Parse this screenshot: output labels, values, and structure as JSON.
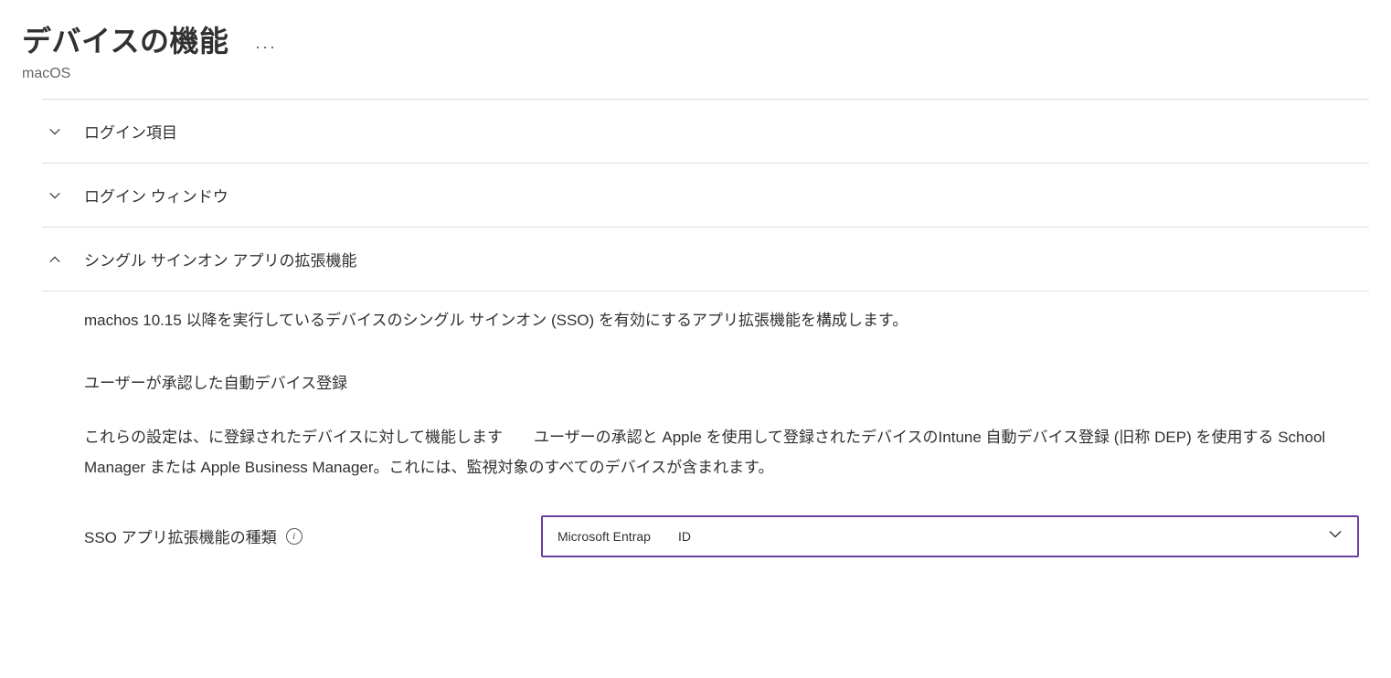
{
  "header": {
    "title": "デバイスの機能",
    "subtitle": "macOS"
  },
  "sections": [
    {
      "label": "ログイン項目",
      "expanded": false
    },
    {
      "label": "ログイン ウィンドウ",
      "expanded": false
    },
    {
      "label": "シングル サインオン アプリの拡張機能",
      "expanded": true
    }
  ],
  "sso": {
    "description": "machos 10.15 以降を実行しているデバイスのシングル サインオン (SSO) を有効にするアプリ拡張機能を構成します。",
    "sub_heading": "ユーザーが承認した自動デバイス登録",
    "paragraph": "これらの設定は、に登録されたデバイスに対して機能します  ユーザーの承認と Apple を使用して登録されたデバイスのIntune 自動デバイス登録 (旧称 DEP) を使用する School Manager または Apple Business Manager。これには、監視対象のすべてのデバイスが含まれます。",
    "field_label": "SSO アプリ拡張機能の種類",
    "select_value_a": "Microsoft Entrap",
    "select_value_b": "ID"
  }
}
